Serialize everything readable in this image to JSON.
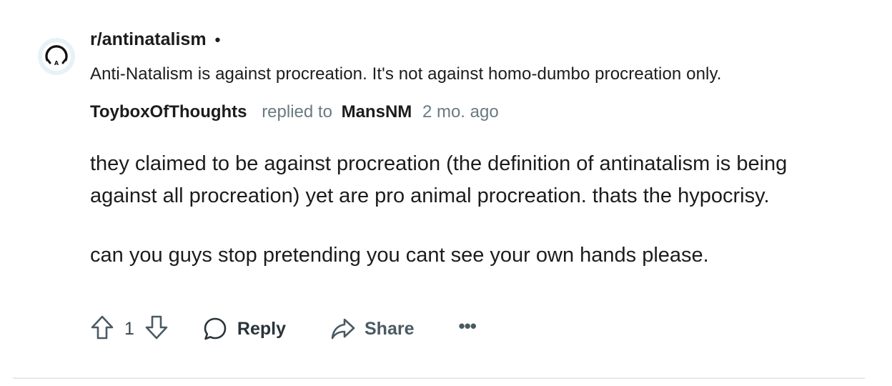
{
  "post": {
    "subreddit": "r/antinatalism",
    "separator": "•",
    "title": "Anti-Natalism is against procreation. It's not against homo-dumbo procreation only."
  },
  "comment": {
    "author": "ToyboxOfThoughts",
    "replied_to_text": "replied to",
    "parent_author": "MansNM",
    "time": "2 mo. ago",
    "paragraphs": [
      "they claimed to be against procreation (the definition of antinatalism is being against all procreation) yet are pro animal procreation. thats the hypocrisy.",
      "can you guys stop pretending you cant see your own hands please."
    ]
  },
  "actions": {
    "vote_count": "1",
    "reply_label": "Reply",
    "share_label": "Share",
    "more_label": "•••"
  },
  "icons": {
    "avatar": "subreddit-avatar-icon",
    "upvote": "upvote-arrow-icon",
    "downvote": "downvote-arrow-icon",
    "reply": "speech-bubble-icon",
    "share": "share-arrow-icon",
    "more": "more-dots-icon"
  },
  "colors": {
    "text_primary": "#1c1c1c",
    "text_muted": "#6a7a83",
    "action_gray": "#4a5a63",
    "avatar_bg": "#e6f2f8",
    "divider": "#e6e9eb"
  }
}
